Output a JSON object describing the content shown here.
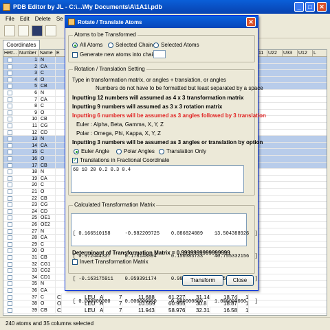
{
  "app": {
    "title": "PDB Editor by JL - C:\\...\\My Documents\\A\\1A1I.pdb",
    "min": "_",
    "max": "□",
    "close": "✕"
  },
  "menu": [
    "File",
    "Edit",
    "Delete",
    "Se"
  ],
  "tabs": [
    "Coordinates"
  ],
  "grid": {
    "left_headers": [
      "Hetr...",
      "Number",
      "Name",
      "E"
    ],
    "right_headers": [
      "11",
      "U22",
      "U33",
      "U12",
      "L"
    ],
    "rows": [
      {
        "num": "1",
        "name": "N",
        "sel": true
      },
      {
        "num": "2",
        "name": "CA",
        "sel": true
      },
      {
        "num": "3",
        "name": "C",
        "sel": true
      },
      {
        "num": "4",
        "name": "O",
        "sel": true
      },
      {
        "num": "5",
        "name": "CB",
        "sel": true
      },
      {
        "num": "6",
        "name": "N",
        "sel": false
      },
      {
        "num": "7",
        "name": "CA",
        "sel": false
      },
      {
        "num": "8",
        "name": "C",
        "sel": false
      },
      {
        "num": "9",
        "name": "O",
        "sel": false
      },
      {
        "num": "10",
        "name": "CB",
        "sel": false
      },
      {
        "num": "11",
        "name": "CG",
        "sel": false
      },
      {
        "num": "12",
        "name": "CD",
        "sel": false
      },
      {
        "num": "13",
        "name": "N",
        "sel": true
      },
      {
        "num": "14",
        "name": "CA",
        "sel": true
      },
      {
        "num": "15",
        "name": "C",
        "sel": true
      },
      {
        "num": "16",
        "name": "O",
        "sel": true
      },
      {
        "num": "17",
        "name": "CB",
        "sel": true
      },
      {
        "num": "18",
        "name": "N",
        "sel": false
      },
      {
        "num": "19",
        "name": "CA",
        "sel": false
      },
      {
        "num": "20",
        "name": "C",
        "sel": false
      },
      {
        "num": "21",
        "name": "O",
        "sel": false
      },
      {
        "num": "22",
        "name": "CB",
        "sel": false
      },
      {
        "num": "23",
        "name": "CG",
        "sel": false
      },
      {
        "num": "24",
        "name": "CD",
        "sel": false
      },
      {
        "num": "25",
        "name": "OE1",
        "sel": false
      },
      {
        "num": "26",
        "name": "OE2",
        "sel": false
      },
      {
        "num": "27",
        "name": "N",
        "sel": false
      },
      {
        "num": "28",
        "name": "CA",
        "sel": false
      },
      {
        "num": "29",
        "name": "C",
        "sel": false
      },
      {
        "num": "30",
        "name": "O",
        "sel": false
      },
      {
        "num": "31",
        "name": "CB",
        "sel": false
      },
      {
        "num": "32",
        "name": "CG1",
        "sel": false
      },
      {
        "num": "33",
        "name": "CG2",
        "sel": false
      },
      {
        "num": "34",
        "name": "CD1",
        "sel": false
      },
      {
        "num": "35",
        "name": "N",
        "sel": false
      },
      {
        "num": "36",
        "name": "CA",
        "sel": false
      },
      {
        "num": "37",
        "name": "C",
        "sel": false
      },
      {
        "num": "38",
        "name": "O",
        "sel": false
      },
      {
        "num": "39",
        "name": "CB",
        "sel": false
      }
    ],
    "bottom_rows": [
      {
        "num": "37",
        "name": "C",
        "el": "C",
        "res": "LEU",
        "ch": "A",
        "seq": "7",
        "x": "11.688",
        "y": "61.227",
        "z": "31.14",
        "occ": "18.74",
        "u": "1"
      },
      {
        "num": "38",
        "name": "O",
        "el": "O",
        "res": "LEU",
        "ch": "A",
        "seq": "7",
        "x": "10.559",
        "y": "60.955",
        "z": "30.8",
        "occ": "18.87",
        "u": "1"
      },
      {
        "num": "39",
        "name": "CB",
        "el": "C",
        "res": "LEU",
        "ch": "A",
        "seq": "7",
        "x": "11.943",
        "y": "58.976",
        "z": "32.31",
        "occ": "16.58",
        "u": "1"
      }
    ]
  },
  "status": "240 atoms and 35 columns selected",
  "dialog": {
    "title": "Rotate / Translate Atoms",
    "group_atoms": "Atoms to be Transformed",
    "radio_all": "All Atoms",
    "radio_chain": "Selected Chain",
    "radio_selected": "Selected Atoms",
    "gen_new": "Generate new atoms into chain :",
    "chain_value": "",
    "group_setting": "Rotation / Translation Setting",
    "line1": "Type in transformation matrix, or angles + translation, or angles",
    "line2": "Numbers do not have to be formatted but least separated by a space",
    "line3": "Inputting 12 numbers will assumed as 4 x 3 transformation matrix",
    "line4": "Inputting 9 numbers will assumed as 3 x 3 rotation matrix",
    "line5": "Inputting 6 numbers will be assumed as 3 angles followed by 3 translation",
    "line6": "Euler : Alpha, Beta, Gamma, X, Y, Z",
    "line7": "Polar : Omega, Phi, Kappa, X, Y, Z",
    "line8": "Inputting 3 numbers will be assumed as 3 angles or translation by option",
    "opt_euler": "Euler Angle",
    "opt_polar": "Polar Angles",
    "opt_trans": "Translation Only",
    "frac_label": "Translations in Fractional Coordinate",
    "input_value": "60 10 20 0.2 0.3 0.4",
    "group_matrix": "Calculated Transformation Matrix",
    "matrix": [
      "[ 0.166510158     -0.982209725    0.086824089    13.504388926  ]",
      "[ 0.972444337     0.178148094     0.150383733    40.755332156  ]",
      "[ -0.163175911    0.059391174     0.984807753    24.560972615  ]",
      "[ 0.000000000     0.000000000     0.000000000    1.000000000   ]"
    ],
    "determinant": "Determinant of Transformation Matrix = 0.9999999999999999",
    "invert_label": "Invert Transformation Matrix",
    "btn_transform": "Transform",
    "btn_close": "Close"
  }
}
